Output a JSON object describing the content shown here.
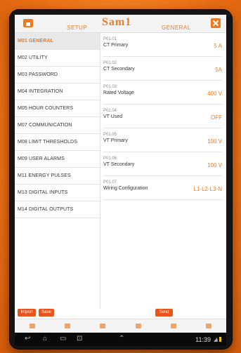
{
  "app": {
    "logo": "Sam1"
  },
  "headers": {
    "setup": "SETUP",
    "general": "GENERAL"
  },
  "menu": [
    {
      "label": "M01 GENERAL",
      "active": true
    },
    {
      "label": "M02 UTILITY"
    },
    {
      "label": "M03 PASSWORD"
    },
    {
      "label": "M04 INTEGRATION"
    },
    {
      "label": "M05 HOUR COUNTERS"
    },
    {
      "label": "M07 COMMUNICATION"
    },
    {
      "label": "M08 LIMIT THRESHOLDS"
    },
    {
      "label": "M09 USER ALARMS"
    },
    {
      "label": "M11 ENERGY PULSES"
    },
    {
      "label": "M13 DIGITAL INPUTS"
    },
    {
      "label": "M14 DIGITAL OUTPUTS"
    }
  ],
  "params": [
    {
      "code": "P01.01",
      "name": "CT Primary",
      "value": "5 A"
    },
    {
      "code": "P01.02",
      "name": "CT Secondary",
      "value": "5A"
    },
    {
      "code": "P01.03",
      "name": "Rated Voltage",
      "value": "400 V"
    },
    {
      "code": "P01.04",
      "name": "VT Used",
      "value": "OFF"
    },
    {
      "code": "P01.05",
      "name": "VT Primary",
      "value": "100 V"
    },
    {
      "code": "P01.06",
      "name": "VT Secondary",
      "value": "100 V"
    },
    {
      "code": "P01.07",
      "name": "Wiring Configuration",
      "value": "L1-L2-L3-N"
    }
  ],
  "buttons": {
    "import": "Import",
    "save": "Save",
    "send": "Send"
  },
  "tabs": [
    "",
    "",
    "",
    "",
    "",
    ""
  ],
  "status": {
    "time": "11:39"
  },
  "colors": {
    "accent": "#f07a1e",
    "button": "#e8541c",
    "background": "#ef7418"
  }
}
